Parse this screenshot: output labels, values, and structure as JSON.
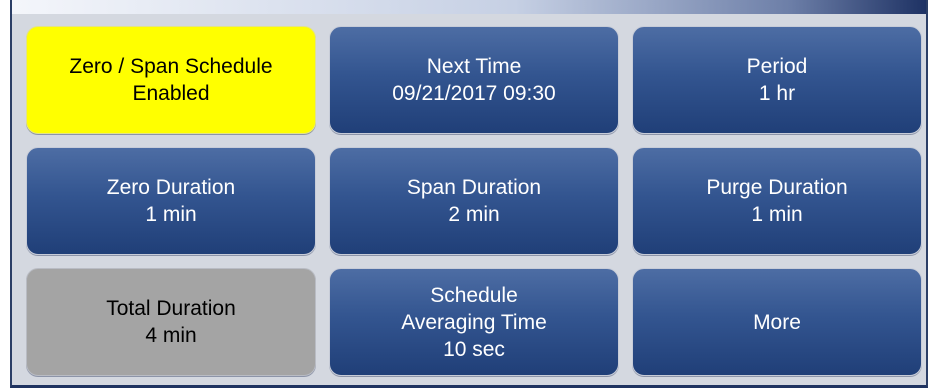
{
  "tiles": {
    "schedule": {
      "line1": "Zero / Span Schedule",
      "line2": "Enabled"
    },
    "next_time": {
      "line1": "Next Time",
      "line2": "09/21/2017 09:30"
    },
    "period": {
      "line1": "Period",
      "line2": "1 hr"
    },
    "zero_duration": {
      "line1": "Zero Duration",
      "line2": "1 min"
    },
    "span_duration": {
      "line1": "Span Duration",
      "line2": "2 min"
    },
    "purge_duration": {
      "line1": "Purge Duration",
      "line2": "1 min"
    },
    "total_duration": {
      "line1": "Total Duration",
      "line2": "4 min"
    },
    "averaging_time": {
      "line1": "Schedule",
      "line2": "Averaging Time",
      "line3": "10 sec"
    },
    "more": {
      "line1": "More"
    }
  },
  "colors": {
    "enabled_tile": "#ffff00",
    "readonly_tile": "#a4a4a4",
    "button_tile": "#335590"
  }
}
